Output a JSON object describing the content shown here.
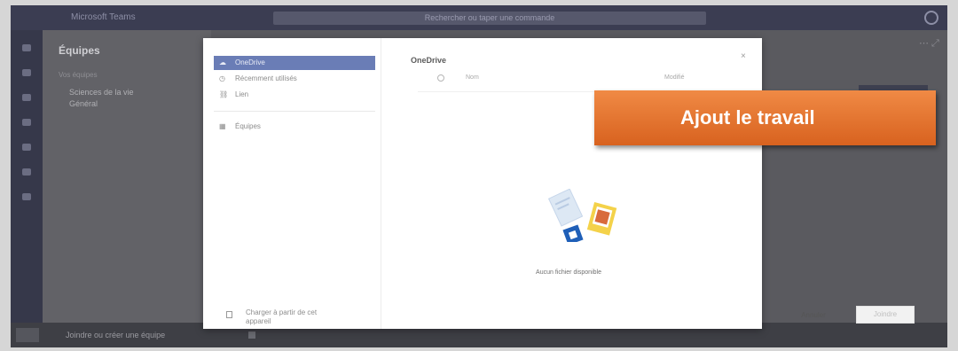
{
  "titlebar": {
    "app_name": "Microsoft Teams",
    "search_placeholder": "Rechercher ou taper une commande"
  },
  "left_panel": {
    "team_title": "Équipes",
    "team_sub": "Vos équipes",
    "team_row_line1": "Sciences de la vie",
    "team_row_line2": "Général"
  },
  "bottom_bar": {
    "text": "Joindre ou créer une équipe"
  },
  "dialog": {
    "nav_items": [
      {
        "icon": "☁",
        "label": "OneDrive"
      },
      {
        "icon": "◷",
        "label": "Récemment utilisés"
      },
      {
        "icon": "⛓",
        "label": "Lien"
      },
      {
        "icon": "▦",
        "label": "Équipes"
      }
    ],
    "upload_label": "Charger à partir de cet appareil",
    "title": "OneDrive",
    "columns": {
      "name": "Nom",
      "modified": "Modifié"
    },
    "empty_text": "Aucun fichier disponible",
    "cancel_label": "Annuler",
    "add_label": "Joindre",
    "close_glyph": "×"
  },
  "callout": {
    "text": "Ajout le travail"
  },
  "colors": {
    "accent": "#6a7db6",
    "callout": "#e8702c",
    "titlebar": "#3b3d52"
  }
}
